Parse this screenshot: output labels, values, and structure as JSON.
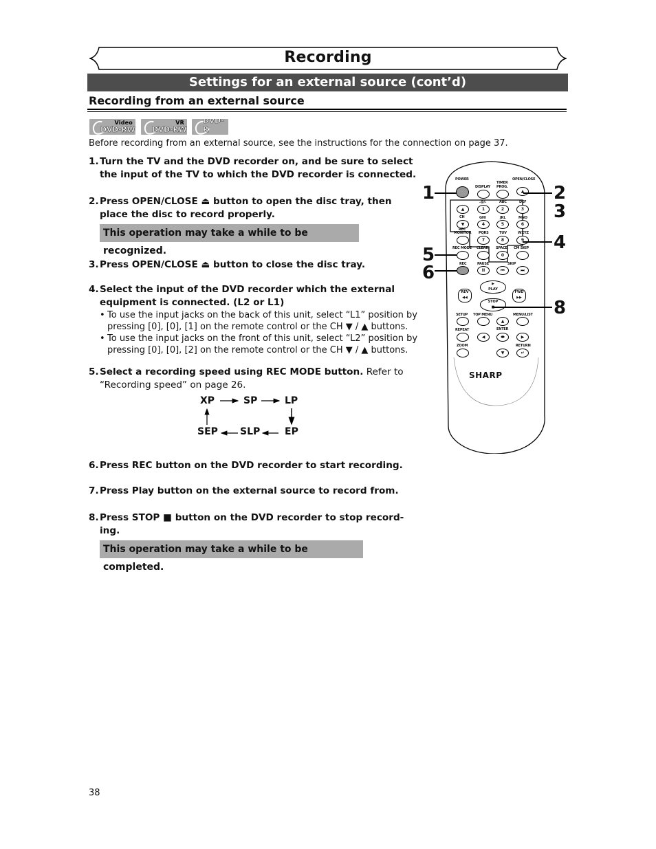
{
  "banner": {
    "title": "Recording"
  },
  "section": {
    "title": "Settings for an external source (cont’d)"
  },
  "subheading": "Recording from an external source",
  "disc_badges": [
    {
      "top": "Video",
      "main": "DVD-RW",
      "icon": "dvd-disc-icon"
    },
    {
      "top": "VR",
      "main": "DVD-RW",
      "icon": "dvd-disc-icon"
    },
    {
      "top": "",
      "main": "DVD-R",
      "icon": "dvd-disc-icon"
    }
  ],
  "intro": "Before recording from an external source, see the instructions for the connection on page 37.",
  "steps": [
    {
      "num": "1.",
      "lines": [
        "Turn the TV and the DVD recorder on, and be sure to select",
        "the input of the TV to which the DVD recorder is connected."
      ]
    },
    {
      "num": "2.",
      "lines": [
        "Press OPEN/CLOSE ⏏ button to open the disc tray, then",
        "place the disc to record properly."
      ]
    },
    {
      "num": "3.",
      "lines": [
        "Press OPEN/CLOSE ⏏ button to close the disc tray."
      ]
    },
    {
      "num": "4.",
      "lines": [
        "Select the input of the DVD recorder which the external",
        "equipment is connected. (L2 or L1)"
      ],
      "bullets": [
        {
          "dot": "•",
          "lines": [
            "To use the input jacks on the back of this unit, select “L1” position by",
            "pressing [0], [0], [1] on the remote control or the CH ▼ / ▲ buttons."
          ]
        },
        {
          "dot": "•",
          "lines": [
            "To use the input jacks on the front of this unit, select “L2” position by",
            "pressing [0], [0], [2] on the remote control or the CH ▼ / ▲ buttons."
          ]
        }
      ]
    },
    {
      "num": "5.",
      "bold": "Select a recording speed using REC MODE button.",
      "normal": " Refer to",
      "line2": "“Recording speed” on page 26."
    },
    {
      "num": "6.",
      "lines": [
        "Press REC button on the DVD recorder to start recording."
      ]
    },
    {
      "num": "7.",
      "lines": [
        "Press Play button on the external source to record from."
      ]
    },
    {
      "num": "8.",
      "lines": [
        "Press STOP ■ button on the DVD recorder to stop record-",
        "ing."
      ]
    }
  ],
  "notes": {
    "recognized": "This operation may take a while to be recognized.",
    "completed": "This operation may take a while to be completed."
  },
  "speed_cycle": [
    "XP",
    "SP",
    "LP",
    "EP",
    "SLP",
    "SEP"
  ],
  "remote": {
    "brand": "SHARP",
    "labels": {
      "power": "POWER",
      "display": "DISPLAY",
      "timer": "TIMER",
      "prog": "PROG.",
      "open_close": "OPEN/CLOSE",
      "k1": ".@/:",
      "k2": "ABC",
      "k3": "DEF",
      "ch": "CH",
      "k4": "GHI",
      "k5": "JKL",
      "k6": "MNO",
      "rec_monitor_1": "REC",
      "rec_monitor_2": "MONITOR",
      "k7": "PQRS",
      "k8": "TUV",
      "k9": "WXYZ",
      "rec_mode": "REC MODE",
      "clear": "CLEAR",
      "space": "SPACE",
      "cm_skip": "CM SKIP",
      "rec": "REC",
      "pause": "PAUSE",
      "skip": "SKIP",
      "play": "PLAY",
      "rev": "REV",
      "fwd": "FWD",
      "stop": "STOP",
      "setup": "SETUP",
      "top_menu": "TOP MENU",
      "menu_list": "MENU/LIST",
      "repeat": "REPEAT",
      "enter": "ENTER",
      "zoom": "ZOOM",
      "return": "RETURN"
    },
    "digits": [
      "1",
      "2",
      "3",
      "4",
      "5",
      "6",
      "7",
      "8",
      "9",
      "0"
    ],
    "callouts": [
      "1",
      "2",
      "3",
      "4",
      "5",
      "6",
      "8"
    ]
  },
  "page_number": "38"
}
